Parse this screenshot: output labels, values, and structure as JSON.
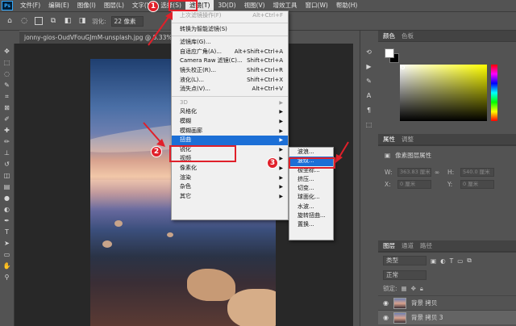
{
  "menubar": {
    "items": [
      "文件(F)",
      "编辑(E)",
      "图像(I)",
      "图层(L)",
      "文字(Y)",
      "选择(S)",
      "滤镜(T)",
      "3D(D)",
      "视图(V)",
      "增效工具",
      "窗口(W)",
      "帮助(H)"
    ]
  },
  "options": {
    "feather_label": "羽化:",
    "feather_value": "22 像素"
  },
  "document": {
    "tab_title": "jonny-gios-OudVFouGJmM-unsplash.jpg @ 8.33% (背景",
    "close": "×"
  },
  "filter_menu": {
    "last_filter": "上次滤镜操作(F)",
    "last_filter_shortcut": "Alt+Ctrl+F",
    "convert_smart": "转换为智能滤镜(S)",
    "gallery": "滤镜库(G)...",
    "adaptive_wide": "自适应广角(A)...",
    "adaptive_wide_shortcut": "Alt+Shift+Ctrl+A",
    "camera_raw": "Camera Raw 滤镜(C)...",
    "camera_raw_shortcut": "Shift+Ctrl+A",
    "lens_correction": "镜头校正(R)...",
    "lens_correction_shortcut": "Shift+Ctrl+R",
    "liquify": "液化(L)...",
    "liquify_shortcut": "Shift+Ctrl+X",
    "vanishing_point": "消失点(V)...",
    "vanishing_point_shortcut": "Alt+Ctrl+V",
    "threed": "3D",
    "stylize": "风格化",
    "blur": "模糊",
    "blur_gallery": "模糊画廊",
    "distort": "扭曲",
    "sharpen": "锐化",
    "video": "视频",
    "pixelate": "像素化",
    "render": "渲染",
    "noise": "杂色",
    "other": "其它"
  },
  "distort_submenu": [
    "波浪...",
    "波纹...",
    "极坐标...",
    "挤压...",
    "切变...",
    "球面化...",
    "水波...",
    "旋转扭曲...",
    "置换..."
  ],
  "annotations": {
    "n1": "1",
    "n2": "2",
    "n3": "3"
  },
  "panels": {
    "color_tabs": [
      "颜色",
      "色板"
    ],
    "prop_tabs": [
      "属性",
      "调整"
    ],
    "pixel_layer": "像素图层属性",
    "w_label": "W:",
    "w_value": "363.83 厘米",
    "h_label": "H:",
    "h_value": "540.0 厘米",
    "x_label": "X:",
    "x_value": "0 厘米",
    "y_label": "Y:",
    "y_value": "0 厘米",
    "layer_tabs": [
      "图层",
      "通道",
      "路径"
    ],
    "kind": "类型",
    "mode": "正常",
    "lock_label": "锁定:",
    "layers": [
      "背景 拷贝",
      "背景 拷贝 3"
    ]
  }
}
